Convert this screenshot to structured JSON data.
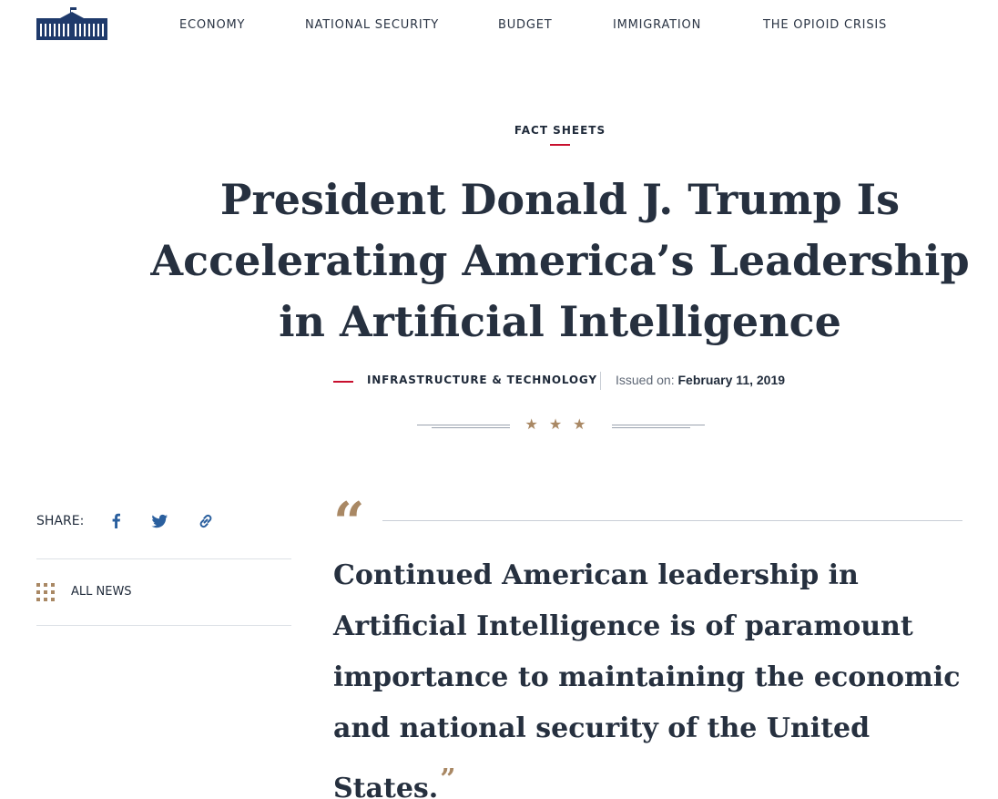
{
  "header": {
    "logo_icon": "white-house-logo",
    "nav": [
      {
        "label": "ECONOMY"
      },
      {
        "label": "NATIONAL SECURITY"
      },
      {
        "label": "BUDGET"
      },
      {
        "label": "IMMIGRATION"
      },
      {
        "label": "THE OPIOID CRISIS"
      }
    ]
  },
  "article": {
    "eyebrow": "FACT SHEETS",
    "title": "President Donald J. Trump Is Accelerating America’s Leadership in Artificial Intelligence",
    "category": "INFRASTRUCTURE & TECHNOLOGY",
    "issued_label": "Issued on:",
    "issued_date": "February 11, 2019",
    "divider_stars": "★★★"
  },
  "sidebar": {
    "share_label": "SHARE:",
    "share_icons": [
      "facebook-icon",
      "twitter-icon",
      "link-icon"
    ],
    "all_news_label": "ALL NEWS"
  },
  "quote": {
    "open_mark": "“",
    "text": "Continued American leadership in Artificial Intelligence is of paramount importance to maintaining the economic and national security of the United States.",
    "close_mark": "”"
  },
  "colors": {
    "navy": "#26303f",
    "accent_red": "#c8102e",
    "gold": "#a98864",
    "twitter_blue": "#2a5f9e"
  }
}
